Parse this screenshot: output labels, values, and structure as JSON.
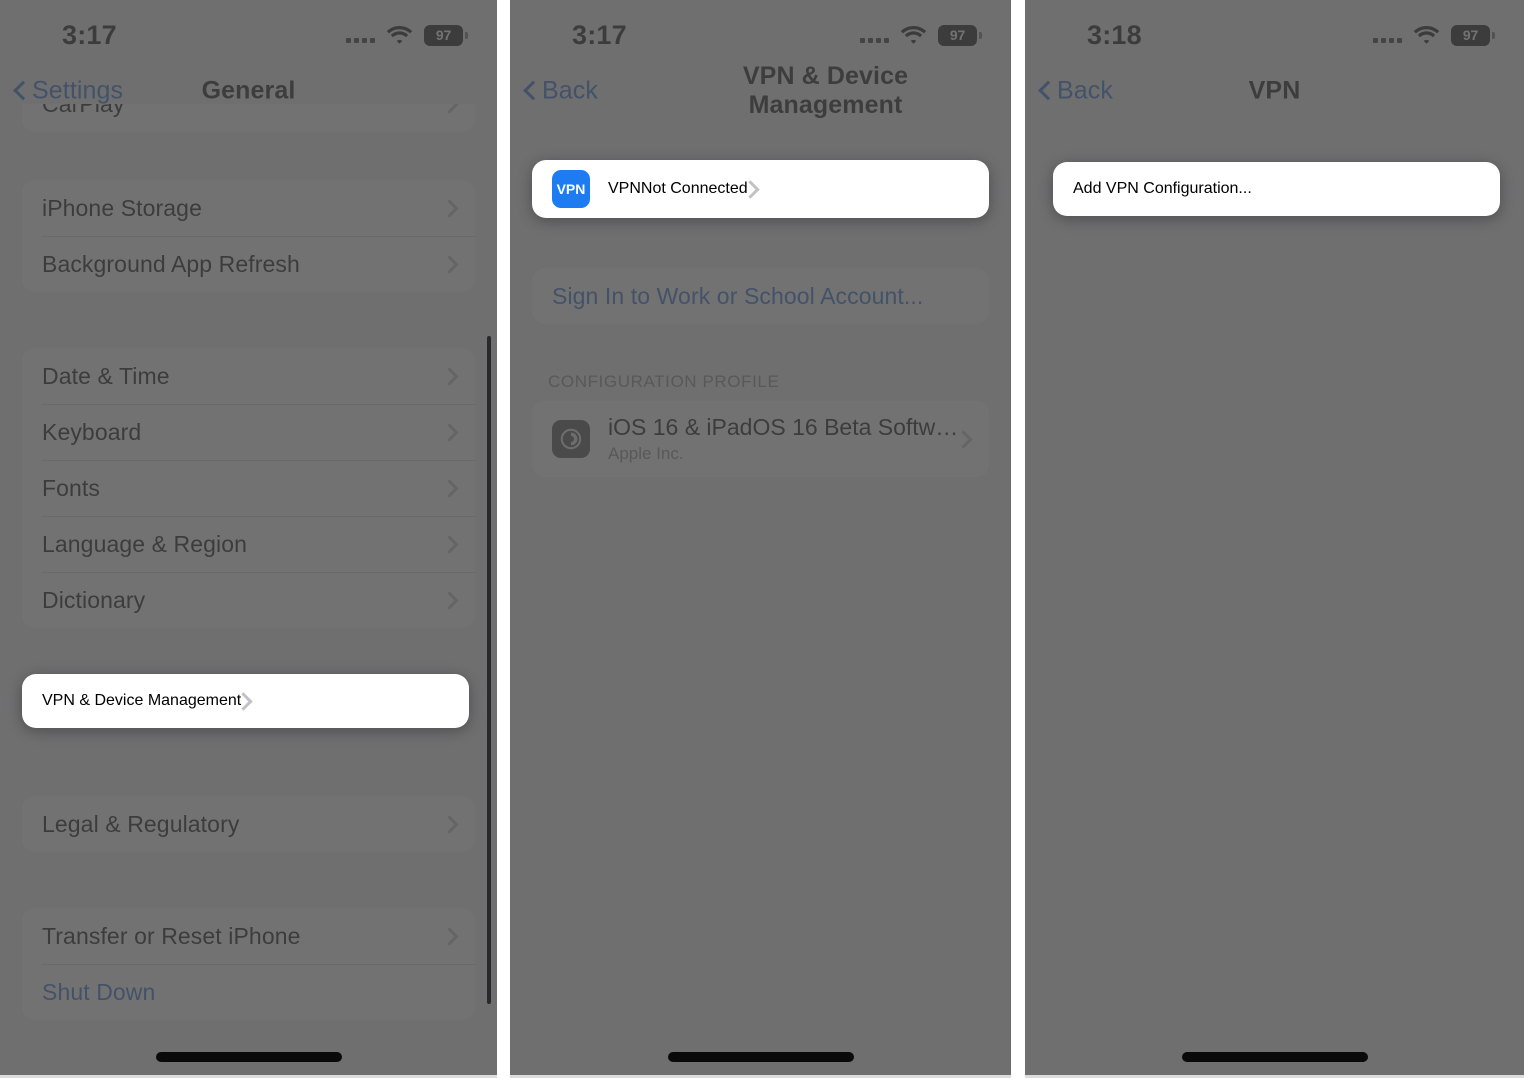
{
  "panels": [
    {
      "status": {
        "time": "3:17",
        "battery": "97",
        "wifi_icon": "wifi-icon",
        "cellular_icon": "cellular-dots-icon"
      },
      "nav": {
        "back_label": "Settings",
        "title": "General",
        "back_icon": "chevron-left-icon"
      },
      "partial_row": {
        "label": "CarPlay",
        "chevron": "chevron-right-icon"
      },
      "group_a": [
        {
          "label": "iPhone Storage",
          "chevron": "chevron-right-icon"
        },
        {
          "label": "Background App Refresh",
          "chevron": "chevron-right-icon"
        }
      ],
      "group_b": [
        {
          "label": "Date & Time",
          "chevron": "chevron-right-icon"
        },
        {
          "label": "Keyboard",
          "chevron": "chevron-right-icon"
        },
        {
          "label": "Fonts",
          "chevron": "chevron-right-icon"
        },
        {
          "label": "Language & Region",
          "chevron": "chevron-right-icon"
        },
        {
          "label": "Dictionary",
          "chevron": "chevron-right-icon"
        }
      ],
      "highlight_row": {
        "label": "VPN & Device Management",
        "chevron": "chevron-right-icon"
      },
      "group_c": [
        {
          "label": "Legal & Regulatory",
          "chevron": "chevron-right-icon"
        }
      ],
      "group_d": [
        {
          "label": "Transfer or Reset iPhone",
          "chevron": "chevron-right-icon"
        },
        {
          "label": "Shut Down",
          "style": "blue"
        }
      ]
    },
    {
      "status": {
        "time": "3:17",
        "battery": "97",
        "wifi_icon": "wifi-icon",
        "cellular_icon": "cellular-dots-icon"
      },
      "nav": {
        "back_label": "Back",
        "title": "VPN & Device Management",
        "back_icon": "chevron-left-icon"
      },
      "highlight_row": {
        "icon": "vpn-app-icon",
        "icon_text": "VPN",
        "label": "VPN",
        "value": "Not Connected",
        "chevron": "chevron-right-icon"
      },
      "sign_in_row": {
        "label": "Sign In to Work or School Account...",
        "style": "blue"
      },
      "section_header": "CONFIGURATION PROFILE",
      "profile_row": {
        "icon": "configuration-profile-icon",
        "title": "iOS 16 & iPadOS 16 Beta Softwar...",
        "subtitle": "Apple Inc.",
        "chevron": "chevron-right-icon"
      }
    },
    {
      "status": {
        "time": "3:18",
        "battery": "97",
        "wifi_icon": "wifi-icon",
        "cellular_icon": "cellular-dots-icon"
      },
      "nav": {
        "back_label": "Back",
        "title": "VPN",
        "back_icon": "chevron-left-icon"
      },
      "highlight_row": {
        "label": "Add VPN Configuration...",
        "style": "blue"
      }
    }
  ],
  "colors": {
    "ios_blue": "#2b6fd1",
    "vpn_icon_blue": "#1d7cf2",
    "dim_overlay": "#4a4a4a",
    "card_white": "#ffffff",
    "page_bg": "#f2f1f6",
    "secondary_text": "#8b8b90"
  }
}
